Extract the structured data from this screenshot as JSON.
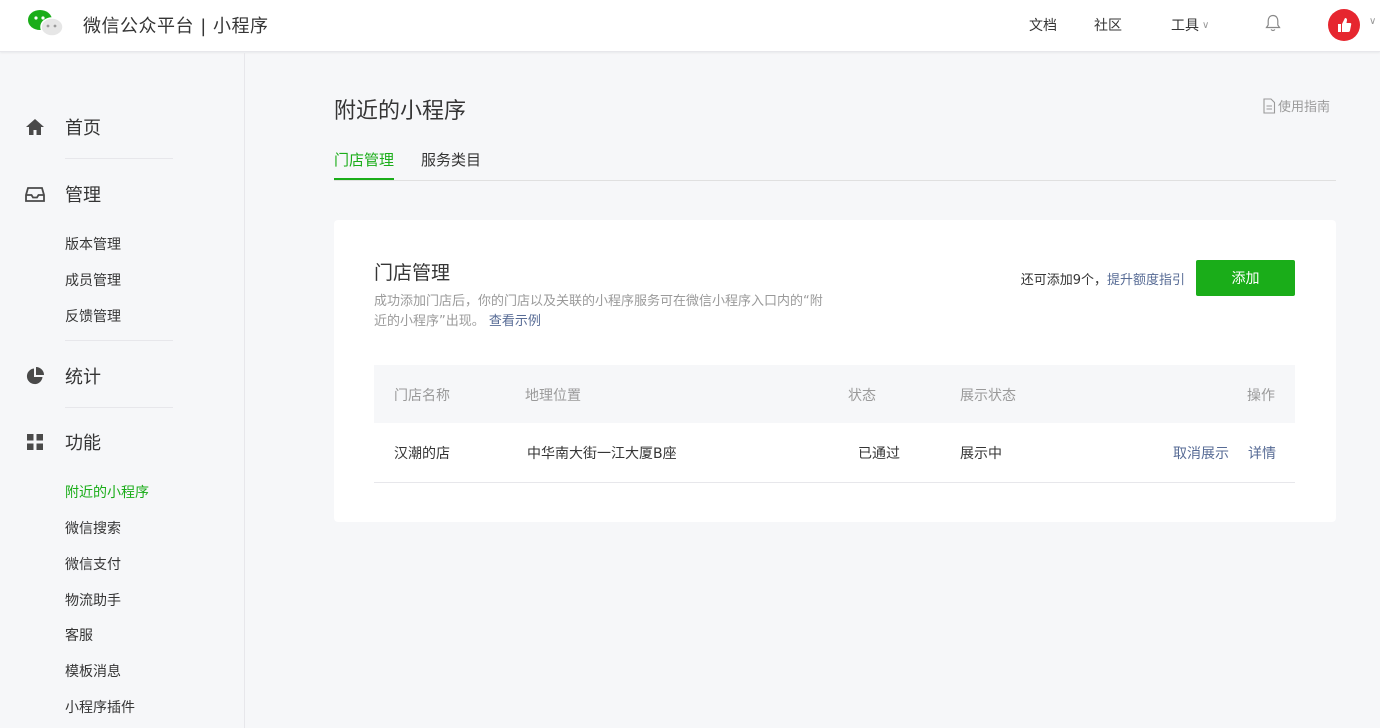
{
  "header": {
    "brand": "微信公众平台 | 小程序",
    "nav": {
      "docs": "文档",
      "community": "社区",
      "tools": "工具"
    }
  },
  "sidebar": {
    "groups": [
      {
        "label": "首页",
        "icon": "home-icon"
      },
      {
        "label": "管理",
        "icon": "inbox-icon",
        "items": [
          "版本管理",
          "成员管理",
          "反馈管理"
        ]
      },
      {
        "label": "统计",
        "icon": "pie-chart-icon"
      },
      {
        "label": "功能",
        "icon": "grid-icon",
        "items": [
          "附近的小程序",
          "微信搜索",
          "微信支付",
          "物流助手",
          "客服",
          "模板消息",
          "小程序插件"
        ]
      }
    ],
    "active_item": "附近的小程序"
  },
  "main": {
    "title": "附近的小程序",
    "guide_link": "使用指南",
    "tabs": [
      {
        "label": "门店管理",
        "active": true
      },
      {
        "label": "服务类目",
        "active": false
      }
    ],
    "card": {
      "title": "门店管理",
      "desc_text": "成功添加门店后，你的门店以及关联的小程序服务可在微信小程序入口内的“附近的小程序”出现。",
      "desc_link": "查看示例",
      "quota_text": "还可添加9个，",
      "quota_link": "提升额度指引",
      "add_label": "添加",
      "table": {
        "headers": [
          "门店名称",
          "地理位置",
          "状态",
          "展示状态",
          "操作"
        ],
        "rows": [
          {
            "name": "汉潮的店",
            "location": "中华南大街一江大厦B座",
            "status": "已通过",
            "display_status": "展示中",
            "actions": [
              "取消展示",
              "详情"
            ]
          }
        ]
      }
    }
  },
  "colors": {
    "accent": "#1aad19",
    "link": "#576b95",
    "avatar": "#e6262f"
  }
}
